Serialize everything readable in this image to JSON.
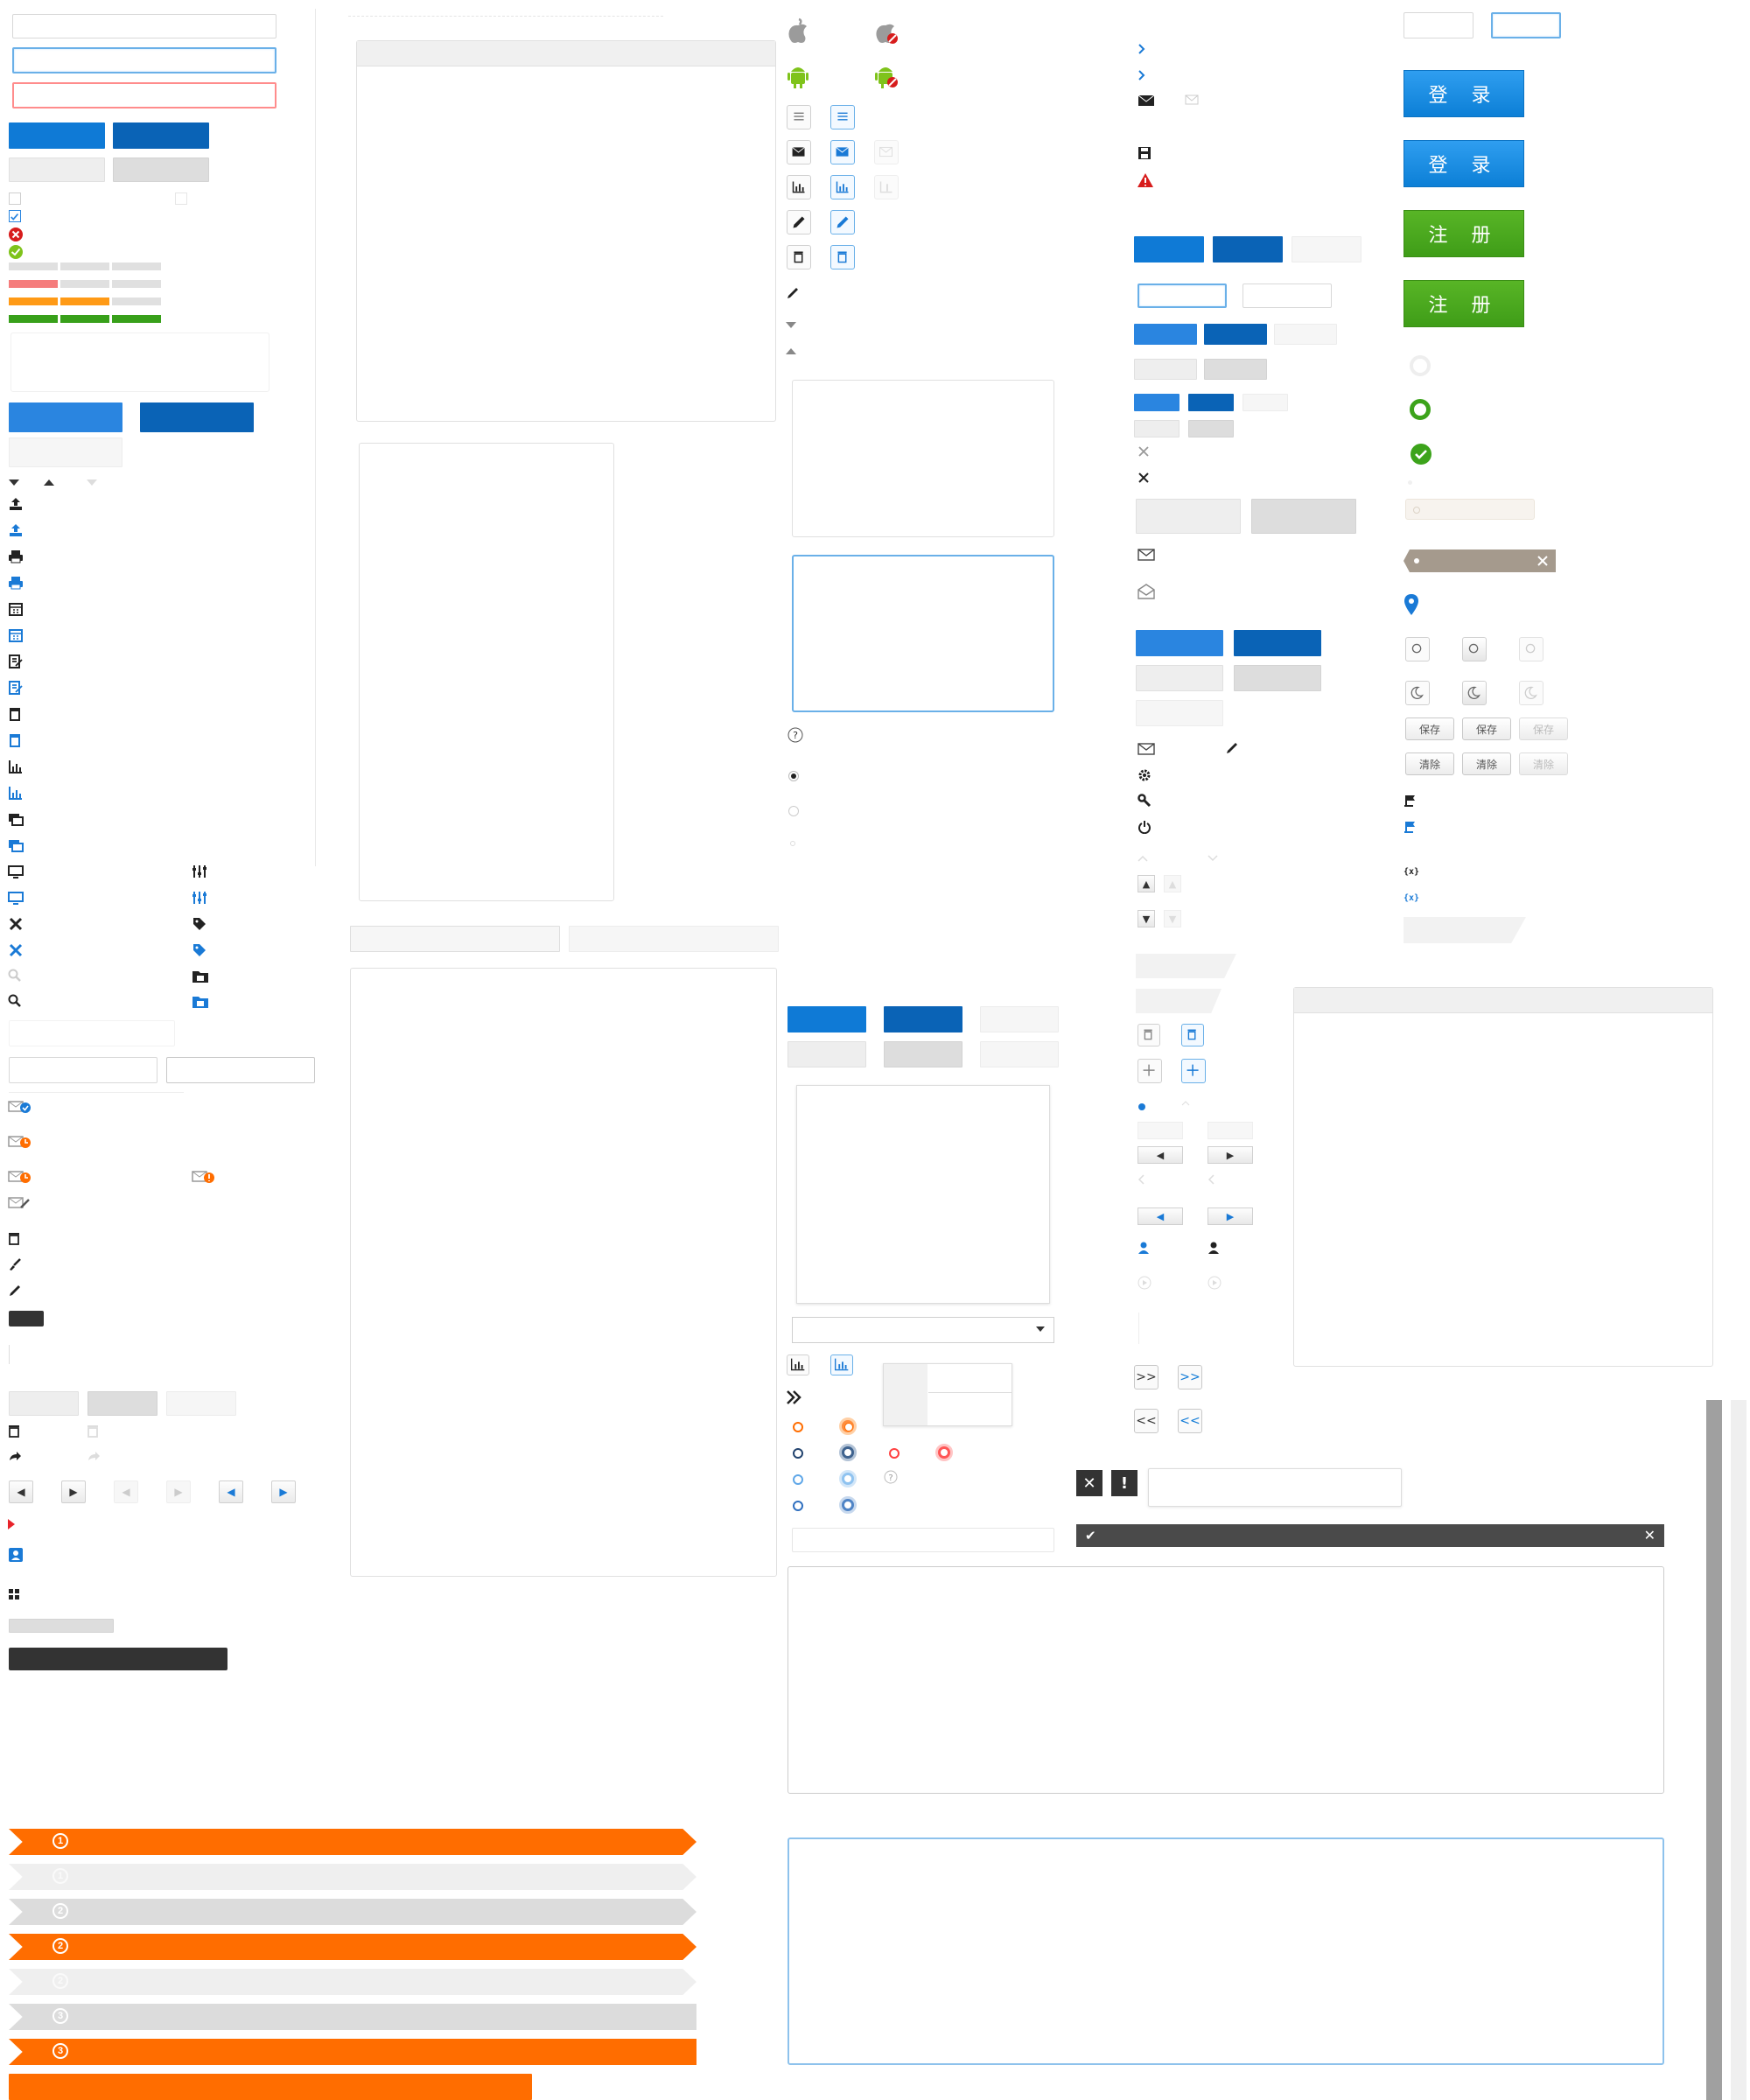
{
  "buttons": {
    "login_primary": "登 录",
    "login_hover": "登 录",
    "register_primary": "注 册",
    "register_hover": "注 册",
    "save_normal": "保存",
    "save_hover": "保存",
    "save_disabled": "保存",
    "clear_normal": "清除",
    "clear_hover": "清除",
    "clear_disabled": "清除"
  },
  "steps": [
    {
      "number": "1",
      "state": "active"
    },
    {
      "number": "1",
      "state": "light"
    },
    {
      "number": "2",
      "state": "mid"
    },
    {
      "number": "2",
      "state": "active"
    },
    {
      "number": "2",
      "state": "light"
    },
    {
      "number": "3",
      "state": "mid"
    },
    {
      "number": "3",
      "state": "active"
    }
  ],
  "nav_symbols": {
    "double_right": "»",
    "double_left": "«",
    "chevrons_right": ">>",
    "chevrons_left": "<<",
    "left": "◀",
    "right": "▶",
    "close": "✕",
    "bang": "!",
    "check": "✔",
    "question": "?",
    "small_right": "›"
  },
  "icons": [
    "apple-icon",
    "android-icon",
    "list-icon",
    "mail-icon",
    "chart-icon",
    "pencil-icon",
    "trash-icon",
    "upload-icon",
    "print-icon",
    "calendar-icon",
    "edit-icon",
    "monitor-icon",
    "tools-icon",
    "search-icon",
    "tag-icon",
    "folder-icon",
    "settings-icon",
    "power-icon",
    "user-icon",
    "flag-icon",
    "warning-icon",
    "save-icon",
    "location-icon",
    "gear-icon"
  ],
  "colors": {
    "primary_blue": "#0f7ad6",
    "dark_blue": "#0a63b6",
    "accent_orange": "#ff6d00",
    "success_green": "#4aa81d",
    "error_red": "#d71c1c",
    "dark_gray": "#333333"
  }
}
